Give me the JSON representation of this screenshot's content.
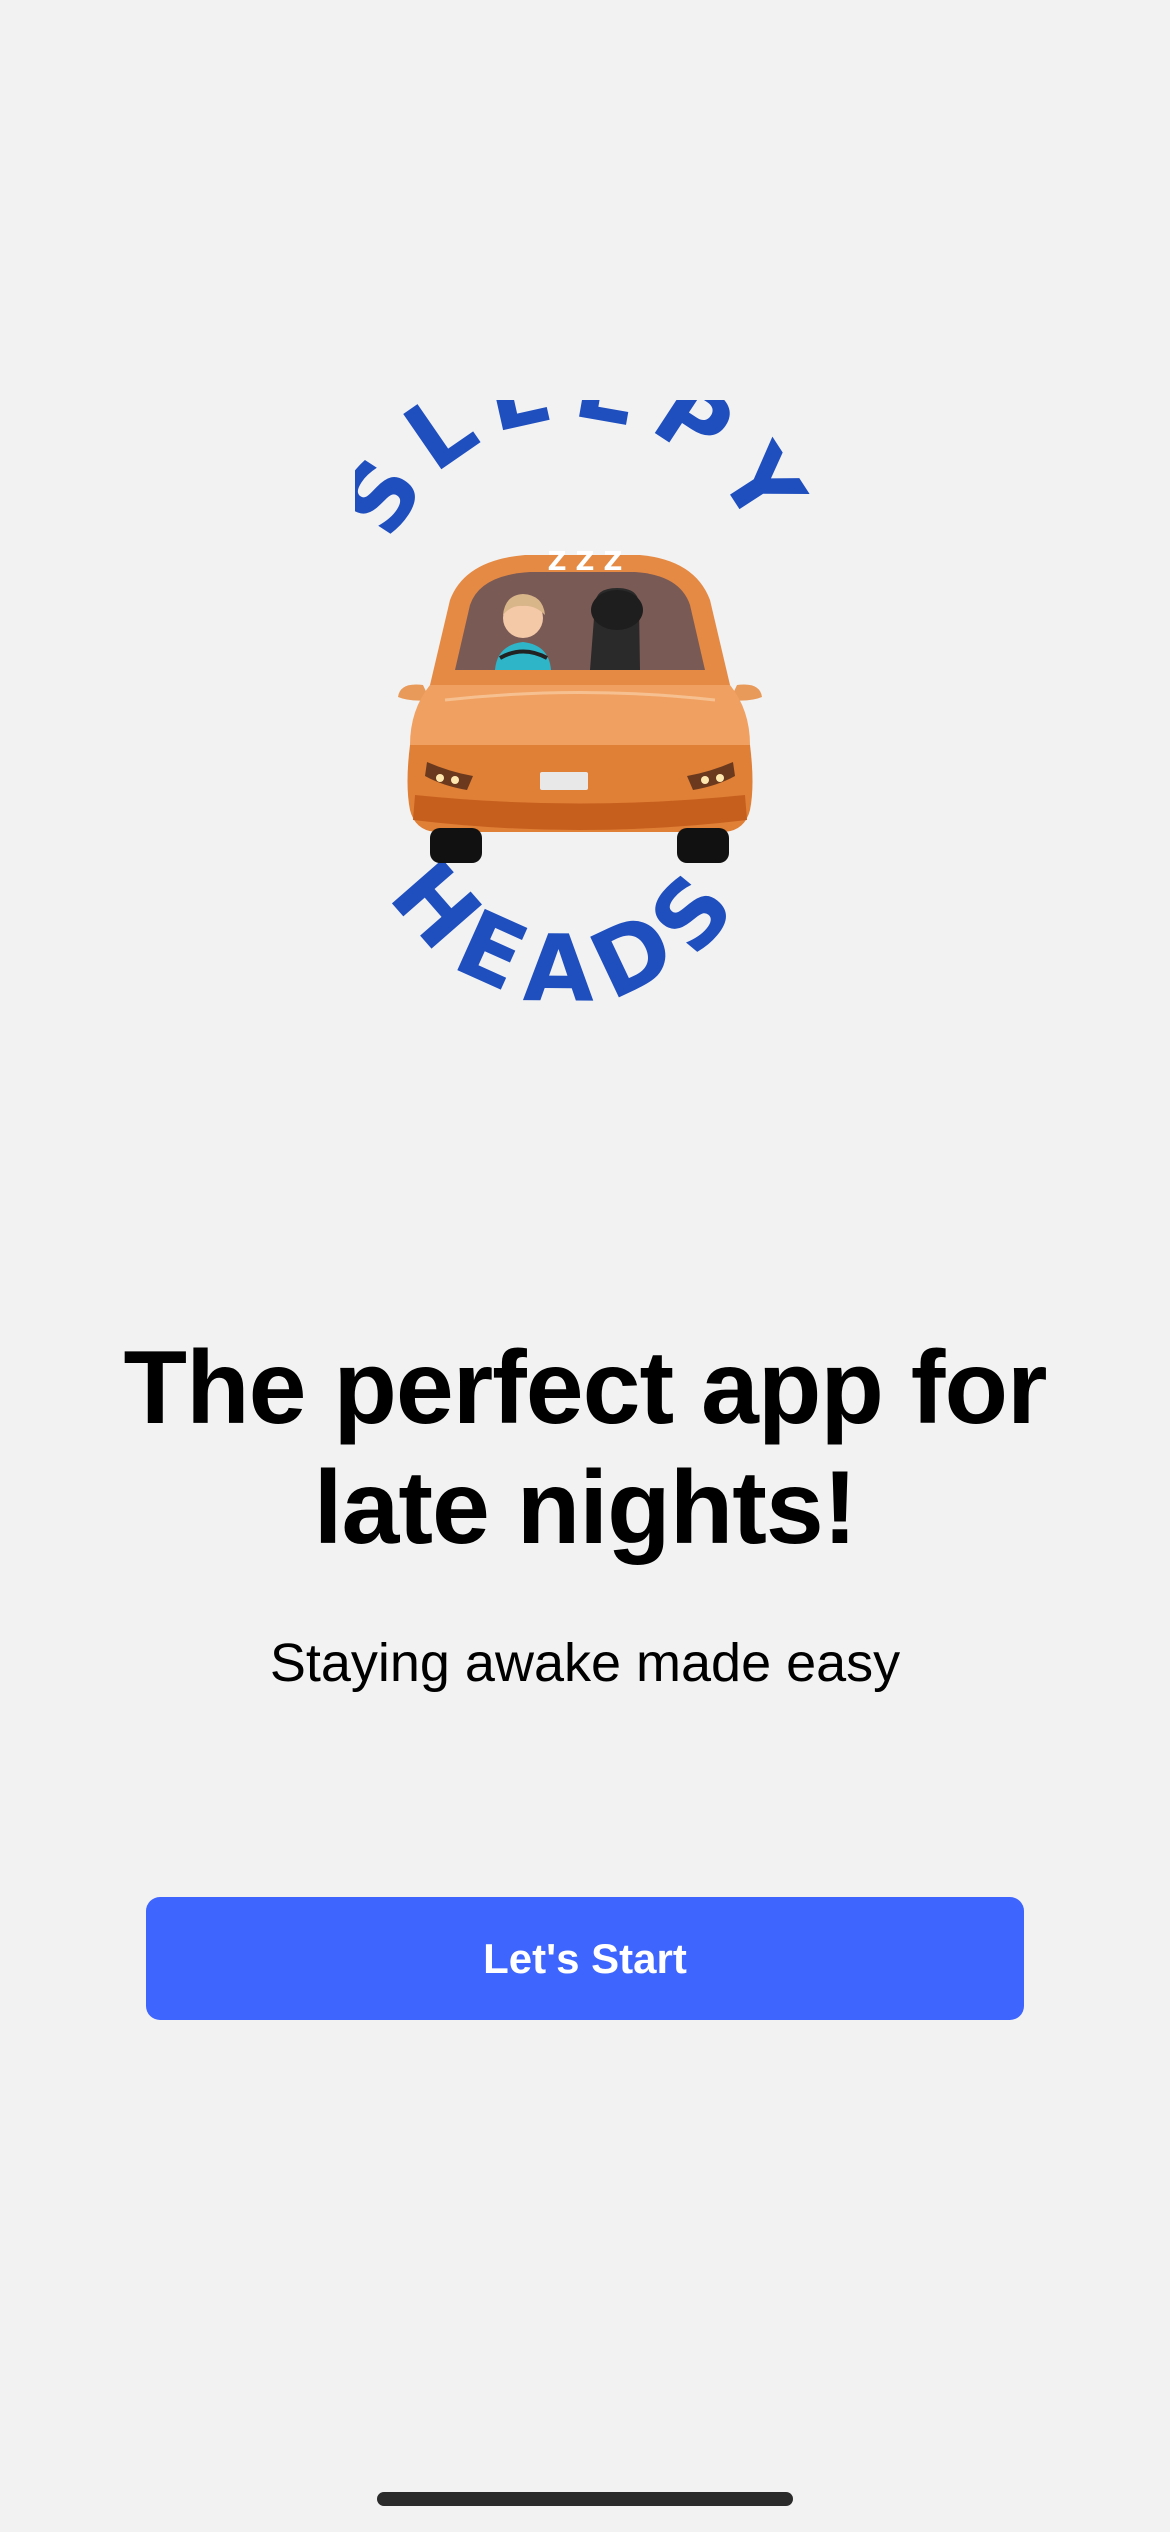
{
  "logo": {
    "top_text": "SLEEPY",
    "bottom_text": "HEADS",
    "snore_text": "Z Z Z"
  },
  "headline": {
    "line1": "The perfect app for",
    "line2": "late nights!"
  },
  "subtitle": "Staying awake made easy",
  "start_button_label": "Let's Start",
  "colors": {
    "background": "#f2f2f2",
    "brand_blue": "#1f4fbf",
    "button": "#3f65ff",
    "car_orange": "#f0a060"
  }
}
